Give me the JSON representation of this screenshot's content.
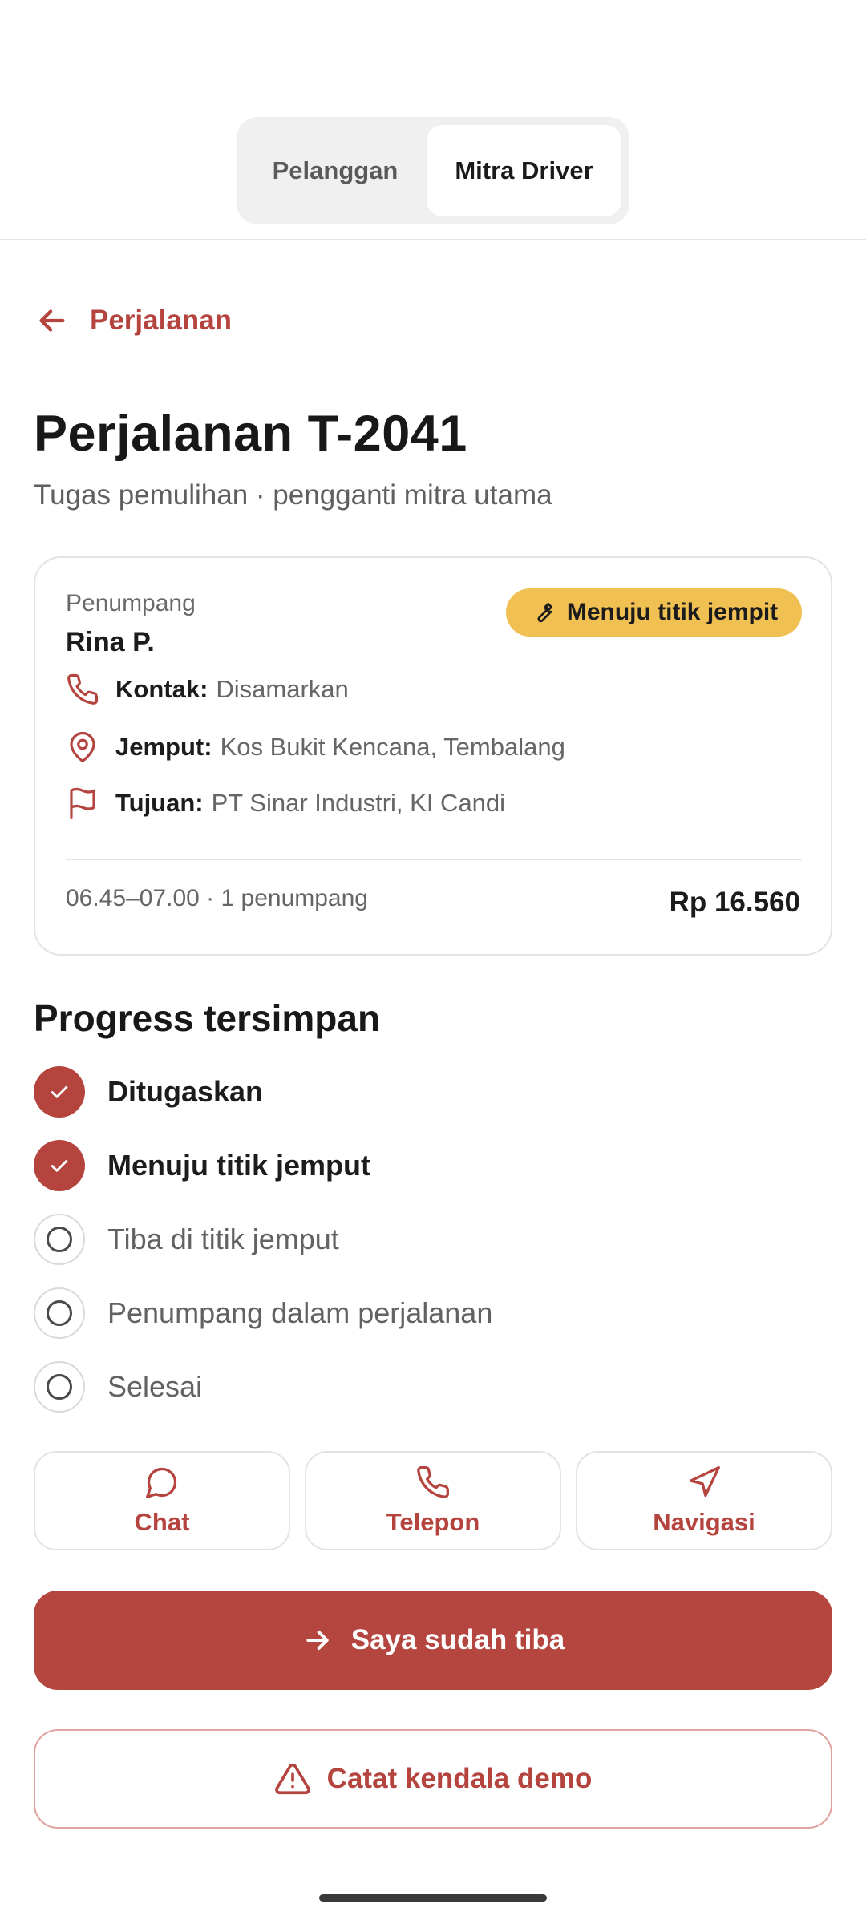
{
  "segment": {
    "left_label": "Pelanggan",
    "right_label": "Mitra Driver",
    "selected": "Mitra Driver"
  },
  "nav": {
    "back_label": "Perjalanan"
  },
  "header": {
    "title": "Perjalanan T-2041",
    "subtitle": "Tugas pemulihan · pengganti mitra utama"
  },
  "card": {
    "passenger_label": "Penumpang",
    "passenger_name": "Rina P.",
    "status_badge": "Menuju titik jempit",
    "contact_key": "Kontak:",
    "contact_value": "Disamarkan",
    "pickup_key": "Jemput:",
    "pickup_value": "Kos Bukit Kencana, Tembalang",
    "dest_key": "Tujuan:",
    "dest_value": "PT Sinar Industri, KI Candi",
    "schedule": "06.45–07.00 · 1 penumpang",
    "price": "Rp 16.560"
  },
  "progress": {
    "title": "Progress tersimpan",
    "steps": [
      {
        "label": "Ditugaskan",
        "done": true
      },
      {
        "label": "Menuju titik jemput",
        "done": true
      },
      {
        "label": "Tiba di titik jemput",
        "done": false
      },
      {
        "label": "Penumpang dalam perjalanan",
        "done": false
      },
      {
        "label": "Selesai",
        "done": false
      }
    ]
  },
  "actions": {
    "chat": "Chat",
    "phone": "Telepon",
    "navigate": "Navigasi"
  },
  "buttons": {
    "primary": "Saya sudah tiba",
    "secondary": "Catat kendala demo"
  },
  "colors": {
    "accent": "#b5443f",
    "badge": "#f1c053",
    "segment_bg": "#f0f0f0"
  },
  "icons": {
    "back": "arrow-left-icon",
    "badge": "wrench-icon",
    "contact": "phone-icon",
    "pickup": "map-pin-icon",
    "dest": "flag-icon",
    "step_done": "check-icon",
    "step_todo": "circle-icon",
    "chat": "chat-bubble-icon",
    "phone": "phone-icon",
    "navigate": "navigation-arrow-icon",
    "primary": "arrow-right-icon",
    "secondary": "warning-triangle-icon"
  }
}
